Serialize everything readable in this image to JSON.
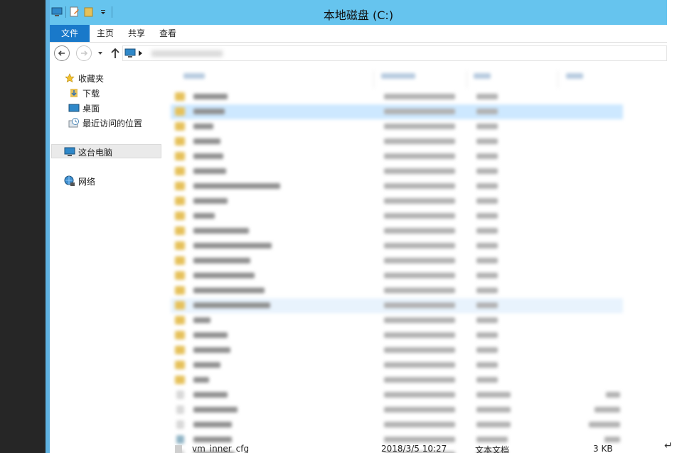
{
  "window": {
    "title": "本地磁盘 (C:)"
  },
  "ribbon": {
    "tabs": [
      {
        "label": "文件"
      },
      {
        "label": "主页"
      },
      {
        "label": "共享"
      },
      {
        "label": "查看"
      }
    ]
  },
  "nav_pane": {
    "items": [
      {
        "label": "收藏夹",
        "icon": "star-icon"
      },
      {
        "label": "下载",
        "icon": "download-folder-icon"
      },
      {
        "label": "桌面",
        "icon": "desktop-icon"
      },
      {
        "label": "最近访问的位置",
        "icon": "recent-places-icon"
      },
      {
        "label": "这台电脑",
        "icon": "this-pc-icon"
      },
      {
        "label": "网络",
        "icon": "network-icon"
      }
    ]
  },
  "file_list": {
    "visible_row": {
      "name": "vm_inner_cfg",
      "date": "2018/3/5 10:27",
      "type": "文本文档",
      "size": "3 KB"
    }
  },
  "colors": {
    "titlebar": "#66c4ee",
    "file_tab": "#1979ca",
    "selected_row": "#cde8ff",
    "folder": "#e6c15a"
  }
}
